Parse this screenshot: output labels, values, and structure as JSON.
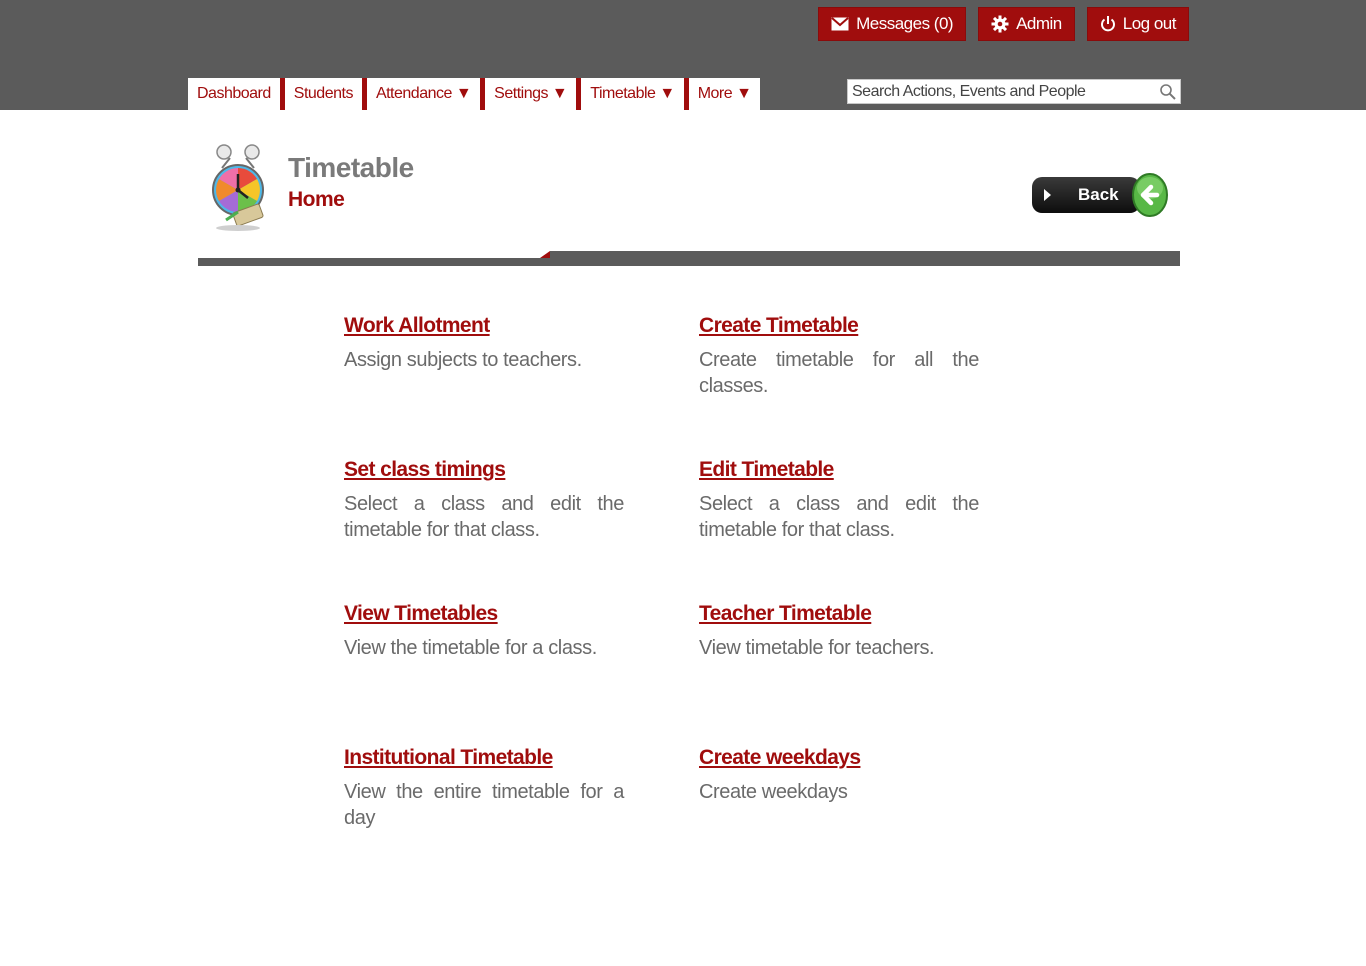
{
  "header": {
    "buttons": {
      "messages": "Messages (0)",
      "admin": "Admin",
      "logout": "Log out"
    },
    "nav": [
      "Dashboard",
      "Students",
      "Attendance ▼",
      "Settings ▼",
      "Timetable ▼",
      "More ▼"
    ],
    "search": {
      "placeholder": "Search Actions, Events and People",
      "icon": "search-icon"
    }
  },
  "page": {
    "title": "Timetable",
    "subtitle": "Home",
    "back_label": "Back"
  },
  "links": [
    {
      "title": "Work Allotment",
      "desc": "Assign subjects to teachers."
    },
    {
      "title": "Create Timetable",
      "desc": "Create timetable for all the classes."
    },
    {
      "title": "Set class timings",
      "desc": "Select a class and edit the timetable for that class."
    },
    {
      "title": "Edit Timetable",
      "desc": "Select a class and edit the timetable for that class."
    },
    {
      "title": "View Timetables",
      "desc": "View the timetable for a class."
    },
    {
      "title": "Teacher Timetable",
      "desc": "View timetable for teachers."
    },
    {
      "title": "Institutional Timetable",
      "desc": "View the entire timetable for a day"
    },
    {
      "title": "Create weekdays",
      "desc": "Create weekdays"
    }
  ],
  "colors": {
    "accent": "#a00d0d",
    "topbar": "#5b5b5b",
    "text_muted": "#6a6a6a"
  }
}
